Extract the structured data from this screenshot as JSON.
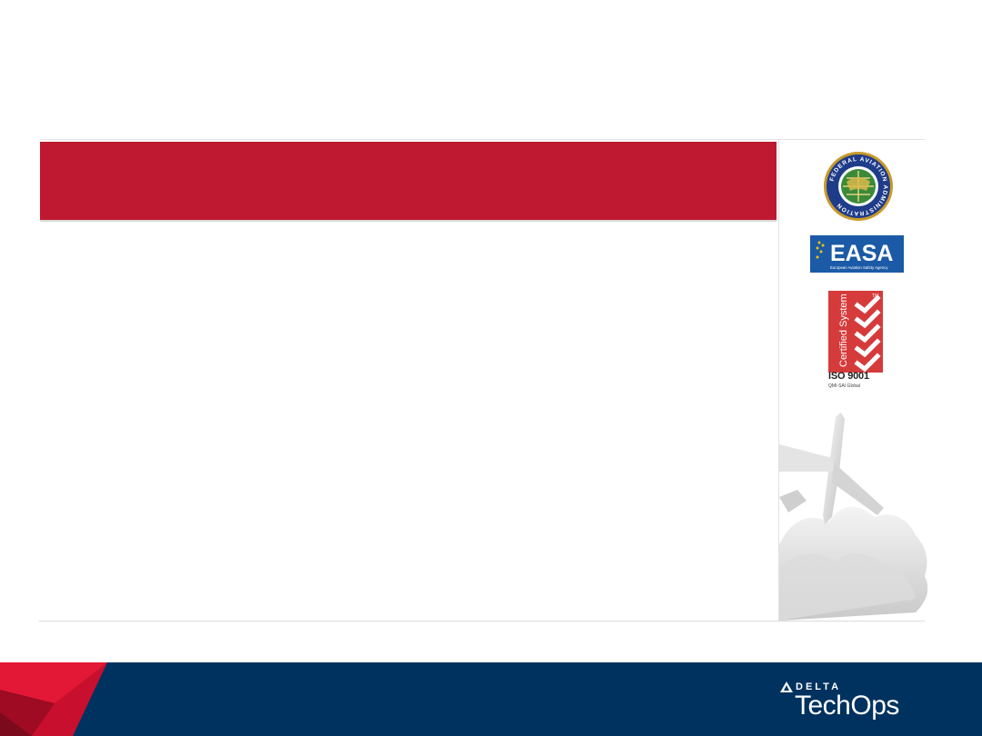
{
  "slide": {
    "title": "",
    "body": ""
  },
  "certifications": {
    "faa": {
      "icon": "faa-seal-icon",
      "ring_text": "FEDERAL AVIATION ADMINISTRATION",
      "color": "#1f3c8a"
    },
    "easa": {
      "icon": "easa-logo-icon",
      "label": "EASA",
      "sub": "European Aviation Safety Agency",
      "color": "#1b5aa6"
    },
    "iso": {
      "icon": "iso-certified-icon",
      "badge_text": "Certified System",
      "label": "ISO 9001",
      "sub": "QMI-SAI Global",
      "color": "#d63b3b"
    }
  },
  "brand": {
    "name": "DELTA",
    "product": "TechOps",
    "footer_color": "#00325f",
    "accent": "#be1931"
  }
}
